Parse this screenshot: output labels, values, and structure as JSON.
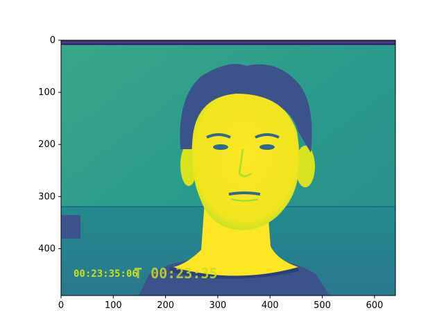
{
  "chart_data": {
    "type": "heatmap",
    "title": "",
    "xlabel": "",
    "ylabel": "",
    "colormap": "viridis",
    "image_extent": {
      "x": [
        0,
        640
      ],
      "y": [
        0,
        490
      ]
    },
    "xlim": [
      0,
      640
    ],
    "ylim": [
      490,
      0
    ],
    "grid": false,
    "x_ticks": [
      0,
      100,
      200,
      300,
      400,
      500,
      600
    ],
    "y_ticks": [
      0,
      100,
      200,
      300,
      400
    ],
    "x_tick_labels": [
      "0",
      "100",
      "200",
      "300",
      "400",
      "500",
      "600"
    ],
    "y_tick_labels": [
      "0",
      "100",
      "200",
      "300",
      "400"
    ]
  },
  "image": {
    "overlay_timecode": "00:23:35:06",
    "overlay_text_2": "T 00:23:35",
    "colors": {
      "background": "#2a9a8c",
      "upper_band": "#31688e",
      "floor": "#2a788e",
      "face_bright": "#fde725",
      "hair_dark": "#3b528b",
      "text_overlay": "#c7e020"
    }
  }
}
